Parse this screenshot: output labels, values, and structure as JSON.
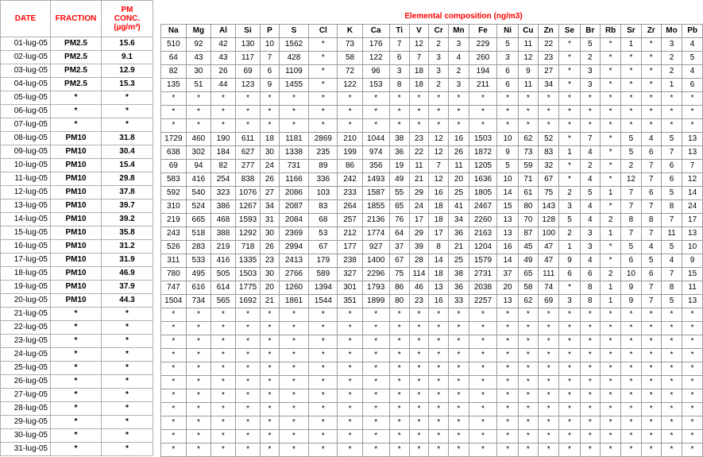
{
  "headers": {
    "date": "DATE",
    "fraction": "FRACTION",
    "pm_conc_line1": "PM",
    "pm_conc_line2": "CONC.",
    "pm_conc_unit": "(µg/m³)",
    "composition_title": "Elemental composition (ng/m3)"
  },
  "elements": [
    "Na",
    "Mg",
    "Al",
    "Si",
    "P",
    "S",
    "Cl",
    "K",
    "Ca",
    "Ti",
    "V",
    "Cr",
    "Mn",
    "Fe",
    "Ni",
    "Cu",
    "Zn",
    "Se",
    "Br",
    "Rb",
    "Sr",
    "Zr",
    "Mo",
    "Pb"
  ],
  "rows": [
    {
      "date": "01-lug-05",
      "fraction": "PM2.5",
      "conc": "15.6",
      "values": [
        "510",
        "92",
        "42",
        "130",
        "10",
        "1562",
        "*",
        "73",
        "176",
        "7",
        "12",
        "2",
        "3",
        "229",
        "5",
        "11",
        "22",
        "*",
        "5",
        "*",
        "1",
        "*",
        "3",
        "4"
      ]
    },
    {
      "date": "02-lug-05",
      "fraction": "PM2.5",
      "conc": "9.1",
      "values": [
        "64",
        "43",
        "43",
        "117",
        "7",
        "428",
        "*",
        "58",
        "122",
        "6",
        "7",
        "3",
        "4",
        "260",
        "3",
        "12",
        "23",
        "*",
        "2",
        "*",
        "*",
        "*",
        "2",
        "5"
      ]
    },
    {
      "date": "03-lug-05",
      "fraction": "PM2.5",
      "conc": "12.9",
      "values": [
        "82",
        "30",
        "26",
        "69",
        "6",
        "1109",
        "*",
        "72",
        "96",
        "3",
        "18",
        "3",
        "2",
        "194",
        "6",
        "9",
        "27",
        "*",
        "3",
        "*",
        "*",
        "*",
        "2",
        "4"
      ]
    },
    {
      "date": "04-lug-05",
      "fraction": "PM2.5",
      "conc": "15.3",
      "values": [
        "135",
        "51",
        "44",
        "123",
        "9",
        "1455",
        "*",
        "122",
        "153",
        "8",
        "18",
        "2",
        "3",
        "211",
        "6",
        "11",
        "34",
        "*",
        "3",
        "*",
        "*",
        "*",
        "1",
        "6"
      ]
    },
    {
      "date": "05-lug-05",
      "fraction": "*",
      "conc": "*",
      "values": [
        "*",
        "*",
        "*",
        "*",
        "*",
        "*",
        "*",
        "*",
        "*",
        "*",
        "*",
        "*",
        "*",
        "*",
        "*",
        "*",
        "*",
        "*",
        "*",
        "*",
        "*",
        "*",
        "*",
        "*"
      ]
    },
    {
      "date": "06-lug-05",
      "fraction": "*",
      "conc": "*",
      "values": [
        "*",
        "*",
        "*",
        "*",
        "*",
        "*",
        "*",
        "*",
        "*",
        "*",
        "*",
        "*",
        "*",
        "*",
        "*",
        "*",
        "*",
        "*",
        "*",
        "*",
        "*",
        "*",
        "*",
        "*"
      ]
    },
    {
      "date": "07-lug-05",
      "fraction": "*",
      "conc": "*",
      "values": [
        "*",
        "*",
        "*",
        "*",
        "*",
        "*",
        "*",
        "*",
        "*",
        "*",
        "*",
        "*",
        "*",
        "*",
        "*",
        "*",
        "*",
        "*",
        "*",
        "*",
        "*",
        "*",
        "*",
        "*"
      ]
    },
    {
      "date": "08-lug-05",
      "fraction": "PM10",
      "conc": "31.8",
      "values": [
        "1729",
        "460",
        "190",
        "611",
        "18",
        "1181",
        "2869",
        "210",
        "1044",
        "38",
        "23",
        "12",
        "16",
        "1503",
        "10",
        "62",
        "52",
        "*",
        "7",
        "*",
        "5",
        "4",
        "5",
        "13"
      ]
    },
    {
      "date": "09-lug-05",
      "fraction": "PM10",
      "conc": "30.4",
      "values": [
        "638",
        "302",
        "184",
        "627",
        "30",
        "1338",
        "235",
        "199",
        "974",
        "36",
        "22",
        "12",
        "26",
        "1872",
        "9",
        "73",
        "83",
        "1",
        "4",
        "*",
        "5",
        "6",
        "7",
        "13"
      ]
    },
    {
      "date": "10-lug-05",
      "fraction": "PM10",
      "conc": "15.4",
      "values": [
        "69",
        "94",
        "82",
        "277",
        "24",
        "731",
        "89",
        "86",
        "356",
        "19",
        "11",
        "7",
        "11",
        "1205",
        "5",
        "59",
        "32",
        "*",
        "2",
        "*",
        "2",
        "7",
        "6",
        "7"
      ]
    },
    {
      "date": "11-lug-05",
      "fraction": "PM10",
      "conc": "29.8",
      "values": [
        "583",
        "416",
        "254",
        "838",
        "26",
        "1166",
        "336",
        "242",
        "1493",
        "49",
        "21",
        "12",
        "20",
        "1636",
        "10",
        "71",
        "67",
        "*",
        "4",
        "*",
        "12",
        "7",
        "6",
        "12"
      ]
    },
    {
      "date": "12-lug-05",
      "fraction": "PM10",
      "conc": "37.8",
      "values": [
        "592",
        "540",
        "323",
        "1076",
        "27",
        "2086",
        "103",
        "233",
        "1587",
        "55",
        "29",
        "16",
        "25",
        "1805",
        "14",
        "61",
        "75",
        "2",
        "5",
        "1",
        "7",
        "6",
        "5",
        "14"
      ]
    },
    {
      "date": "13-lug-05",
      "fraction": "PM10",
      "conc": "39.7",
      "values": [
        "310",
        "524",
        "386",
        "1267",
        "34",
        "2087",
        "83",
        "264",
        "1855",
        "65",
        "24",
        "18",
        "41",
        "2467",
        "15",
        "80",
        "143",
        "3",
        "4",
        "*",
        "7",
        "7",
        "8",
        "24"
      ]
    },
    {
      "date": "14-lug-05",
      "fraction": "PM10",
      "conc": "39.2",
      "values": [
        "219",
        "665",
        "468",
        "1593",
        "31",
        "2084",
        "68",
        "257",
        "2136",
        "76",
        "17",
        "18",
        "34",
        "2260",
        "13",
        "70",
        "128",
        "5",
        "4",
        "2",
        "8",
        "8",
        "7",
        "17"
      ]
    },
    {
      "date": "15-lug-05",
      "fraction": "PM10",
      "conc": "35.8",
      "values": [
        "243",
        "518",
        "388",
        "1292",
        "30",
        "2369",
        "53",
        "212",
        "1774",
        "64",
        "29",
        "17",
        "36",
        "2163",
        "13",
        "87",
        "100",
        "2",
        "3",
        "1",
        "7",
        "7",
        "11",
        "13"
      ]
    },
    {
      "date": "16-lug-05",
      "fraction": "PM10",
      "conc": "31.2",
      "values": [
        "526",
        "283",
        "219",
        "718",
        "26",
        "2994",
        "67",
        "177",
        "927",
        "37",
        "39",
        "8",
        "21",
        "1204",
        "16",
        "45",
        "47",
        "1",
        "3",
        "*",
        "5",
        "4",
        "5",
        "10"
      ]
    },
    {
      "date": "17-lug-05",
      "fraction": "PM10",
      "conc": "31.9",
      "values": [
        "311",
        "533",
        "416",
        "1335",
        "23",
        "2413",
        "179",
        "238",
        "1400",
        "67",
        "28",
        "14",
        "25",
        "1579",
        "14",
        "49",
        "47",
        "9",
        "4",
        "*",
        "6",
        "5",
        "4",
        "9"
      ]
    },
    {
      "date": "18-lug-05",
      "fraction": "PM10",
      "conc": "46.9",
      "values": [
        "780",
        "495",
        "505",
        "1503",
        "30",
        "2766",
        "589",
        "327",
        "2296",
        "75",
        "114",
        "18",
        "38",
        "2731",
        "37",
        "65",
        "111",
        "6",
        "6",
        "2",
        "10",
        "6",
        "7",
        "15"
      ]
    },
    {
      "date": "19-lug-05",
      "fraction": "PM10",
      "conc": "37.9",
      "values": [
        "747",
        "616",
        "614",
        "1775",
        "20",
        "1260",
        "1394",
        "301",
        "1793",
        "86",
        "46",
        "13",
        "36",
        "2038",
        "20",
        "58",
        "74",
        "*",
        "8",
        "1",
        "9",
        "7",
        "8",
        "11"
      ]
    },
    {
      "date": "20-lug-05",
      "fraction": "PM10",
      "conc": "44.3",
      "values": [
        "1504",
        "734",
        "565",
        "1692",
        "21",
        "1861",
        "1544",
        "351",
        "1899",
        "80",
        "23",
        "16",
        "33",
        "2257",
        "13",
        "62",
        "69",
        "3",
        "8",
        "1",
        "9",
        "7",
        "5",
        "13"
      ]
    },
    {
      "date": "21-lug-05",
      "fraction": "*",
      "conc": "*",
      "values": [
        "*",
        "*",
        "*",
        "*",
        "*",
        "*",
        "*",
        "*",
        "*",
        "*",
        "*",
        "*",
        "*",
        "*",
        "*",
        "*",
        "*",
        "*",
        "*",
        "*",
        "*",
        "*",
        "*",
        "*"
      ]
    },
    {
      "date": "22-lug-05",
      "fraction": "*",
      "conc": "*",
      "values": [
        "*",
        "*",
        "*",
        "*",
        "*",
        "*",
        "*",
        "*",
        "*",
        "*",
        "*",
        "*",
        "*",
        "*",
        "*",
        "*",
        "*",
        "*",
        "*",
        "*",
        "*",
        "*",
        "*",
        "*"
      ]
    },
    {
      "date": "23-lug-05",
      "fraction": "*",
      "conc": "*",
      "values": [
        "*",
        "*",
        "*",
        "*",
        "*",
        "*",
        "*",
        "*",
        "*",
        "*",
        "*",
        "*",
        "*",
        "*",
        "*",
        "*",
        "*",
        "*",
        "*",
        "*",
        "*",
        "*",
        "*",
        "*"
      ]
    },
    {
      "date": "24-lug-05",
      "fraction": "*",
      "conc": "*",
      "values": [
        "*",
        "*",
        "*",
        "*",
        "*",
        "*",
        "*",
        "*",
        "*",
        "*",
        "*",
        "*",
        "*",
        "*",
        "*",
        "*",
        "*",
        "*",
        "*",
        "*",
        "*",
        "*",
        "*",
        "*"
      ]
    },
    {
      "date": "25-lug-05",
      "fraction": "*",
      "conc": "*",
      "values": [
        "*",
        "*",
        "*",
        "*",
        "*",
        "*",
        "*",
        "*",
        "*",
        "*",
        "*",
        "*",
        "*",
        "*",
        "*",
        "*",
        "*",
        "*",
        "*",
        "*",
        "*",
        "*",
        "*",
        "*"
      ]
    },
    {
      "date": "26-lug-05",
      "fraction": "*",
      "conc": "*",
      "values": [
        "*",
        "*",
        "*",
        "*",
        "*",
        "*",
        "*",
        "*",
        "*",
        "*",
        "*",
        "*",
        "*",
        "*",
        "*",
        "*",
        "*",
        "*",
        "*",
        "*",
        "*",
        "*",
        "*",
        "*"
      ]
    },
    {
      "date": "27-lug-05",
      "fraction": "*",
      "conc": "*",
      "values": [
        "*",
        "*",
        "*",
        "*",
        "*",
        "*",
        "*",
        "*",
        "*",
        "*",
        "*",
        "*",
        "*",
        "*",
        "*",
        "*",
        "*",
        "*",
        "*",
        "*",
        "*",
        "*",
        "*",
        "*"
      ]
    },
    {
      "date": "28-lug-05",
      "fraction": "*",
      "conc": "*",
      "values": [
        "*",
        "*",
        "*",
        "*",
        "*",
        "*",
        "*",
        "*",
        "*",
        "*",
        "*",
        "*",
        "*",
        "*",
        "*",
        "*",
        "*",
        "*",
        "*",
        "*",
        "*",
        "*",
        "*",
        "*"
      ]
    },
    {
      "date": "29-lug-05",
      "fraction": "*",
      "conc": "*",
      "values": [
        "*",
        "*",
        "*",
        "*",
        "*",
        "*",
        "*",
        "*",
        "*",
        "*",
        "*",
        "*",
        "*",
        "*",
        "*",
        "*",
        "*",
        "*",
        "*",
        "*",
        "*",
        "*",
        "*",
        "*"
      ]
    },
    {
      "date": "30-lug-05",
      "fraction": "*",
      "conc": "*",
      "values": [
        "*",
        "*",
        "*",
        "*",
        "*",
        "*",
        "*",
        "*",
        "*",
        "*",
        "*",
        "*",
        "*",
        "*",
        "*",
        "*",
        "*",
        "*",
        "*",
        "*",
        "*",
        "*",
        "*",
        "*"
      ]
    },
    {
      "date": "31-lug-05",
      "fraction": "*",
      "conc": "*",
      "values": [
        "*",
        "*",
        "*",
        "*",
        "*",
        "*",
        "*",
        "*",
        "*",
        "*",
        "*",
        "*",
        "*",
        "*",
        "*",
        "*",
        "*",
        "*",
        "*",
        "*",
        "*",
        "*",
        "*",
        "*"
      ]
    }
  ]
}
